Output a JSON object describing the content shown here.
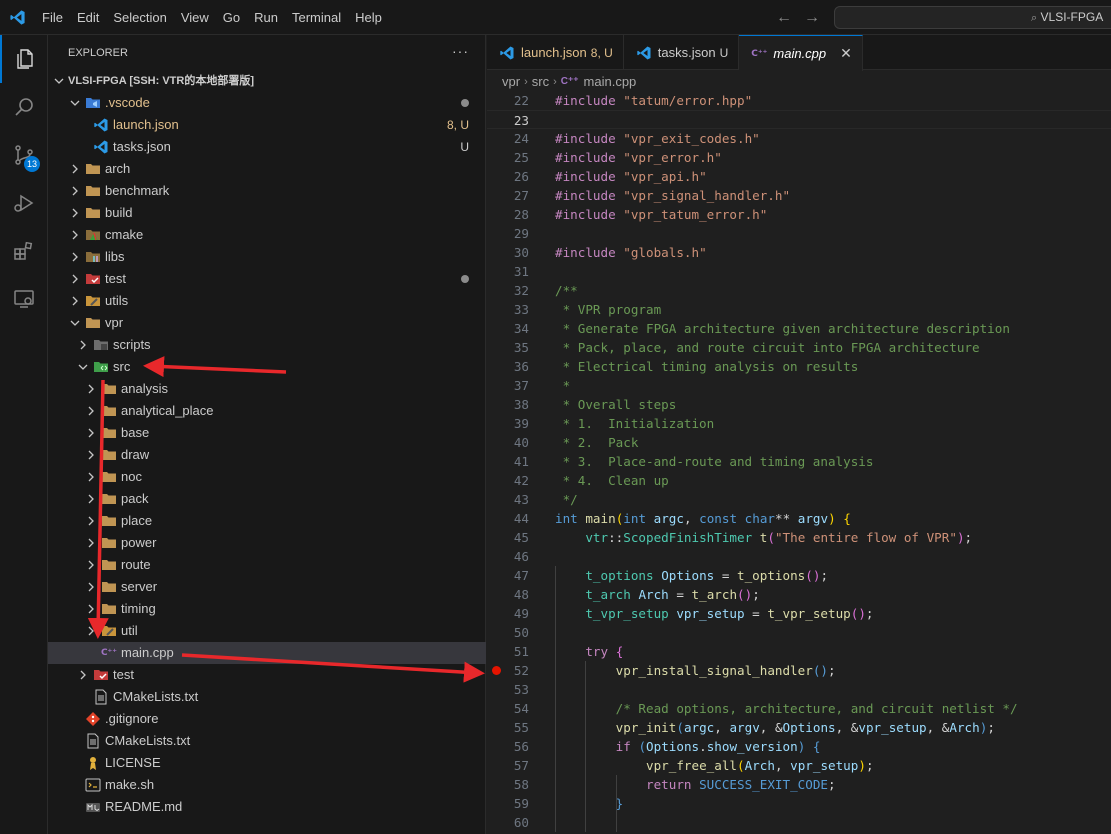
{
  "titlebar": {
    "menu": [
      "File",
      "Edit",
      "Selection",
      "View",
      "Go",
      "Run",
      "Terminal",
      "Help"
    ],
    "back_glyph": "←",
    "forward_glyph": "→",
    "search_text": "VLSI-FPGA"
  },
  "activity_bar": {
    "items": [
      "explorer-icon",
      "search-icon",
      "source-control-icon",
      "run-debug-icon",
      "extensions-icon",
      "remote-explorer-icon"
    ],
    "source_control_badge": "13"
  },
  "explorer": {
    "header": "EXPLORER",
    "more": "···",
    "root": "VLSI-FPGA [SSH: VTR的本地部署版]",
    "tree": [
      {
        "label": ".vscode",
        "depth": 1,
        "type": "folder",
        "expanded": true,
        "color": "#e2c08d",
        "dot": true,
        "icon": "vscode-folder"
      },
      {
        "label": "launch.json",
        "depth": 2,
        "type": "file",
        "color": "#e2c08d",
        "decoration": "8, U",
        "icon": "vscode-file"
      },
      {
        "label": "tasks.json",
        "depth": 2,
        "type": "file",
        "color": "#cccccc",
        "decoration": "U",
        "icon": "vscode-file"
      },
      {
        "label": "arch",
        "depth": 1,
        "type": "folder",
        "expanded": false,
        "icon": "folder"
      },
      {
        "label": "benchmark",
        "depth": 1,
        "type": "folder",
        "expanded": false,
        "icon": "folder"
      },
      {
        "label": "build",
        "depth": 1,
        "type": "folder",
        "expanded": false,
        "icon": "folder"
      },
      {
        "label": "cmake",
        "depth": 1,
        "type": "folder",
        "expanded": false,
        "icon": "cmake-folder"
      },
      {
        "label": "libs",
        "depth": 1,
        "type": "folder",
        "expanded": false,
        "icon": "lib-folder"
      },
      {
        "label": "test",
        "depth": 1,
        "type": "folder",
        "expanded": false,
        "icon": "test-folder",
        "dot": true
      },
      {
        "label": "utils",
        "depth": 1,
        "type": "folder",
        "expanded": false,
        "icon": "utils-folder"
      },
      {
        "label": "vpr",
        "depth": 1,
        "type": "folder",
        "expanded": true,
        "icon": "folder"
      },
      {
        "label": "scripts",
        "depth": 2,
        "type": "folder",
        "expanded": false,
        "icon": "scripts-folder"
      },
      {
        "label": "src",
        "depth": 2,
        "type": "folder",
        "expanded": true,
        "icon": "src-folder"
      },
      {
        "label": "analysis",
        "depth": 3,
        "type": "folder",
        "expanded": false,
        "icon": "folder"
      },
      {
        "label": "analytical_place",
        "depth": 3,
        "type": "folder",
        "expanded": false,
        "icon": "folder"
      },
      {
        "label": "base",
        "depth": 3,
        "type": "folder",
        "expanded": false,
        "icon": "folder"
      },
      {
        "label": "draw",
        "depth": 3,
        "type": "folder",
        "expanded": false,
        "icon": "folder"
      },
      {
        "label": "noc",
        "depth": 3,
        "type": "folder",
        "expanded": false,
        "icon": "folder"
      },
      {
        "label": "pack",
        "depth": 3,
        "type": "folder",
        "expanded": false,
        "icon": "folder"
      },
      {
        "label": "place",
        "depth": 3,
        "type": "folder",
        "expanded": false,
        "icon": "folder"
      },
      {
        "label": "power",
        "depth": 3,
        "type": "folder",
        "expanded": false,
        "icon": "folder"
      },
      {
        "label": "route",
        "depth": 3,
        "type": "folder",
        "expanded": false,
        "icon": "folder"
      },
      {
        "label": "server",
        "depth": 3,
        "type": "folder",
        "expanded": false,
        "icon": "folder"
      },
      {
        "label": "timing",
        "depth": 3,
        "type": "folder",
        "expanded": false,
        "icon": "folder"
      },
      {
        "label": "util",
        "depth": 3,
        "type": "folder",
        "expanded": false,
        "icon": "utils-folder"
      },
      {
        "label": "main.cpp",
        "depth": 3,
        "type": "file",
        "icon": "cpp-file",
        "selected": true
      },
      {
        "label": "test",
        "depth": 2,
        "type": "folder",
        "expanded": false,
        "icon": "test-folder"
      },
      {
        "label": "CMakeLists.txt",
        "depth": 2,
        "type": "file",
        "icon": "text-file"
      },
      {
        "label": ".gitignore",
        "depth": 1,
        "type": "file",
        "icon": "git-file"
      },
      {
        "label": "CMakeLists.txt",
        "depth": 1,
        "type": "file",
        "icon": "text-file"
      },
      {
        "label": "LICENSE",
        "depth": 1,
        "type": "file",
        "icon": "license-file"
      },
      {
        "label": "make.sh",
        "depth": 1,
        "type": "file",
        "icon": "shell-file"
      },
      {
        "label": "README.md",
        "depth": 1,
        "type": "file",
        "icon": "markdown-file"
      }
    ]
  },
  "tabs": [
    {
      "label": "launch.json",
      "decoration": "8, U",
      "color": "#e2c08d",
      "icon": "vscode-file",
      "active": false
    },
    {
      "label": "tasks.json",
      "decoration": "U",
      "color": "#cccccc",
      "icon": "vscode-file",
      "active": false
    },
    {
      "label": "main.cpp",
      "decoration": "",
      "color": "#ffffff",
      "icon": "cpp-file",
      "active": true,
      "italic": true,
      "close": "✕"
    }
  ],
  "breadcrumbs": [
    "vpr",
    "src",
    "main.cpp"
  ],
  "editor": {
    "current_line": 23,
    "breakpoint_line": 52,
    "lines": [
      {
        "n": 22,
        "t": [
          [
            "d",
            "#include "
          ],
          [
            "s",
            "\"tatum/error.hpp\""
          ]
        ]
      },
      {
        "n": 23,
        "t": []
      },
      {
        "n": 24,
        "t": [
          [
            "d",
            "#include "
          ],
          [
            "s",
            "\"vpr_exit_codes.h\""
          ]
        ]
      },
      {
        "n": 25,
        "t": [
          [
            "d",
            "#include "
          ],
          [
            "s",
            "\"vpr_error.h\""
          ]
        ]
      },
      {
        "n": 26,
        "t": [
          [
            "d",
            "#include "
          ],
          [
            "s",
            "\"vpr_api.h\""
          ]
        ]
      },
      {
        "n": 27,
        "t": [
          [
            "d",
            "#include "
          ],
          [
            "s",
            "\"vpr_signal_handler.h\""
          ]
        ]
      },
      {
        "n": 28,
        "t": [
          [
            "d",
            "#include "
          ],
          [
            "s",
            "\"vpr_tatum_error.h\""
          ]
        ]
      },
      {
        "n": 29,
        "t": []
      },
      {
        "n": 30,
        "t": [
          [
            "d",
            "#include "
          ],
          [
            "s",
            "\"globals.h\""
          ]
        ]
      },
      {
        "n": 31,
        "t": []
      },
      {
        "n": 32,
        "t": [
          [
            "c",
            "/**"
          ]
        ]
      },
      {
        "n": 33,
        "t": [
          [
            "c",
            " * VPR program"
          ]
        ]
      },
      {
        "n": 34,
        "t": [
          [
            "c",
            " * Generate FPGA architecture given architecture description"
          ]
        ]
      },
      {
        "n": 35,
        "t": [
          [
            "c",
            " * Pack, place, and route circuit into FPGA architecture"
          ]
        ]
      },
      {
        "n": 36,
        "t": [
          [
            "c",
            " * Electrical timing analysis on results"
          ]
        ]
      },
      {
        "n": 37,
        "t": [
          [
            "c",
            " *"
          ]
        ]
      },
      {
        "n": 38,
        "t": [
          [
            "c",
            " * Overall steps"
          ]
        ]
      },
      {
        "n": 39,
        "t": [
          [
            "c",
            " * 1.  Initialization"
          ]
        ]
      },
      {
        "n": 40,
        "t": [
          [
            "c",
            " * 2.  Pack"
          ]
        ]
      },
      {
        "n": 41,
        "t": [
          [
            "c",
            " * 3.  Place-and-route and timing analysis"
          ]
        ]
      },
      {
        "n": 42,
        "t": [
          [
            "c",
            " * 4.  Clean up"
          ]
        ]
      },
      {
        "n": 43,
        "t": [
          [
            "c",
            " */"
          ]
        ]
      },
      {
        "n": 44,
        "t": [
          [
            "k",
            "int"
          ],
          [
            "p",
            " "
          ],
          [
            "f",
            "main"
          ],
          [
            "b",
            "("
          ],
          [
            "k",
            "int"
          ],
          [
            "p",
            " "
          ],
          [
            "v",
            "argc"
          ],
          [
            "p",
            ", "
          ],
          [
            "k",
            "const"
          ],
          [
            "p",
            " "
          ],
          [
            "k",
            "char"
          ],
          [
            "p",
            "** "
          ],
          [
            "v",
            "argv"
          ],
          [
            "b",
            ")"
          ],
          [
            "p",
            " "
          ],
          [
            "b",
            "{"
          ]
        ]
      },
      {
        "n": 45,
        "t": [
          [
            "p",
            "    "
          ],
          [
            "ty",
            "vtr"
          ],
          [
            "p",
            "::"
          ],
          [
            "ty",
            "ScopedFinishTimer"
          ],
          [
            "p",
            " "
          ],
          [
            "f",
            "t"
          ],
          [
            "b2",
            "("
          ],
          [
            "s",
            "\"The entire flow of VPR\""
          ],
          [
            "b2",
            ")"
          ],
          [
            "p",
            ";"
          ]
        ]
      },
      {
        "n": 46,
        "t": []
      },
      {
        "n": 47,
        "t": [
          [
            "p",
            "    "
          ],
          [
            "ty",
            "t_options"
          ],
          [
            "p",
            " "
          ],
          [
            "v",
            "Options"
          ],
          [
            "p",
            " = "
          ],
          [
            "f",
            "t_options"
          ],
          [
            "b2",
            "()"
          ],
          [
            "p",
            ";"
          ]
        ]
      },
      {
        "n": 48,
        "t": [
          [
            "p",
            "    "
          ],
          [
            "ty",
            "t_arch"
          ],
          [
            "p",
            " "
          ],
          [
            "v",
            "Arch"
          ],
          [
            "p",
            " = "
          ],
          [
            "f",
            "t_arch"
          ],
          [
            "b2",
            "()"
          ],
          [
            "p",
            ";"
          ]
        ]
      },
      {
        "n": 49,
        "t": [
          [
            "p",
            "    "
          ],
          [
            "ty",
            "t_vpr_setup"
          ],
          [
            "p",
            " "
          ],
          [
            "v",
            "vpr_setup"
          ],
          [
            "p",
            " = "
          ],
          [
            "f",
            "t_vpr_setup"
          ],
          [
            "b2",
            "()"
          ],
          [
            "p",
            ";"
          ]
        ]
      },
      {
        "n": 50,
        "t": []
      },
      {
        "n": 51,
        "t": [
          [
            "p",
            "    "
          ],
          [
            "d",
            "try"
          ],
          [
            "p",
            " "
          ],
          [
            "b2",
            "{"
          ]
        ]
      },
      {
        "n": 52,
        "t": [
          [
            "p",
            "        "
          ],
          [
            "f",
            "vpr_install_signal_handler"
          ],
          [
            "k",
            "()"
          ],
          [
            "p",
            ";"
          ]
        ]
      },
      {
        "n": 53,
        "t": []
      },
      {
        "n": 54,
        "t": [
          [
            "p",
            "        "
          ],
          [
            "c",
            "/* Read options, architecture, and circuit netlist */"
          ]
        ]
      },
      {
        "n": 55,
        "t": [
          [
            "p",
            "        "
          ],
          [
            "f",
            "vpr_init"
          ],
          [
            "k",
            "("
          ],
          [
            "v",
            "argc"
          ],
          [
            "p",
            ", "
          ],
          [
            "v",
            "argv"
          ],
          [
            "p",
            ", &"
          ],
          [
            "v",
            "Options"
          ],
          [
            "p",
            ", &"
          ],
          [
            "v",
            "vpr_setup"
          ],
          [
            "p",
            ", &"
          ],
          [
            "v",
            "Arch"
          ],
          [
            "k",
            ")"
          ],
          [
            "p",
            ";"
          ]
        ]
      },
      {
        "n": 56,
        "t": [
          [
            "p",
            "        "
          ],
          [
            "d",
            "if"
          ],
          [
            "p",
            " "
          ],
          [
            "k",
            "("
          ],
          [
            "v",
            "Options"
          ],
          [
            "p",
            "."
          ],
          [
            "v",
            "show_version"
          ],
          [
            "k",
            ")"
          ],
          [
            "p",
            " "
          ],
          [
            "k",
            "{"
          ]
        ]
      },
      {
        "n": 57,
        "t": [
          [
            "p",
            "            "
          ],
          [
            "f",
            "vpr_free_all"
          ],
          [
            "b",
            "("
          ],
          [
            "v",
            "Arch"
          ],
          [
            "p",
            ", "
          ],
          [
            "v",
            "vpr_setup"
          ],
          [
            "b",
            ")"
          ],
          [
            "p",
            ";"
          ]
        ]
      },
      {
        "n": 58,
        "t": [
          [
            "p",
            "            "
          ],
          [
            "d",
            "return"
          ],
          [
            "p",
            " "
          ],
          [
            "k",
            "SUCCESS_EXIT_CODE"
          ],
          [
            "p",
            ";"
          ]
        ]
      },
      {
        "n": 59,
        "t": [
          [
            "p",
            "        "
          ],
          [
            "k",
            "}"
          ]
        ]
      },
      {
        "n": 60,
        "t": []
      }
    ]
  },
  "colors": {
    "accent": "#0078d4",
    "annotation_arrow": "#e8282b",
    "breakpoint": "#e51400",
    "modified_file": "#e2c08d"
  }
}
